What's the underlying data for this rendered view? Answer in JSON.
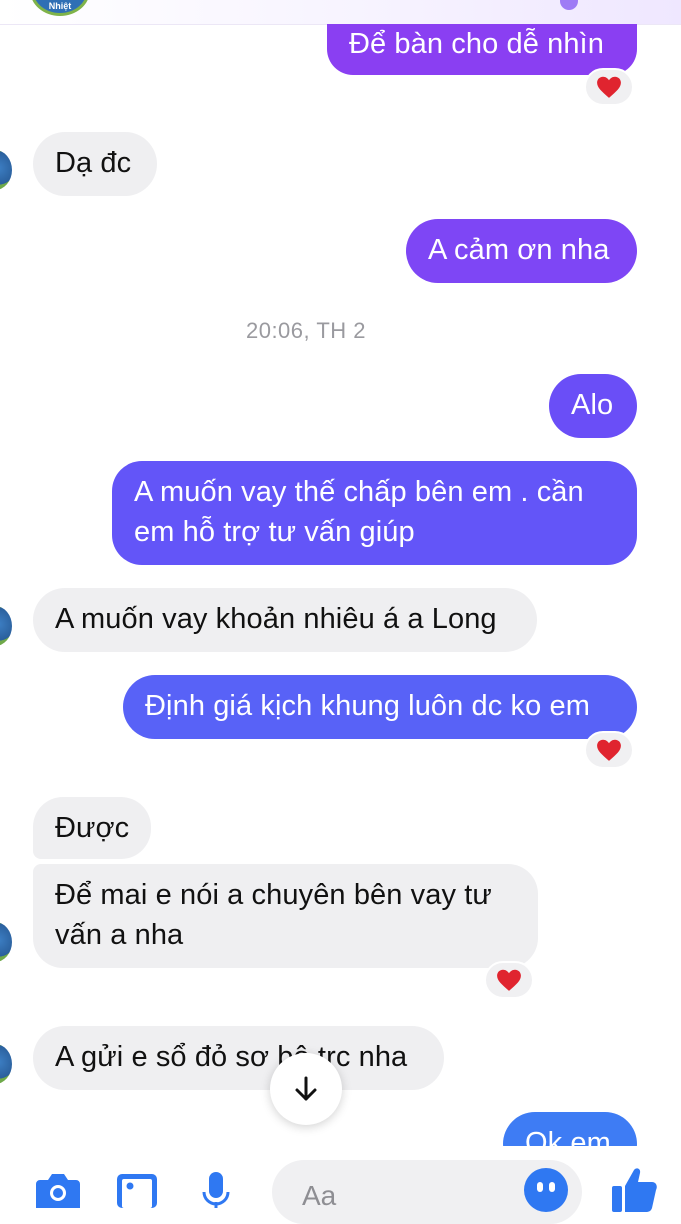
{
  "header": {
    "avatar_text": "Nhiệt"
  },
  "messages": {
    "sent_1": "Để bàn cho dễ nhìn",
    "recv_1": "Dạ đc",
    "sent_2": "A cảm ơn nha",
    "timestamp": "20:06, TH 2",
    "sent_3": "Alo",
    "sent_4": "A muốn vay thế chấp bên em . cần\nem hỗ trợ tư vấn giúp",
    "recv_2": "A muốn vay khoản nhiêu á a Long",
    "sent_5": "Định giá kịch khung luôn dc ko em",
    "recv_3": "Được",
    "recv_4": "Để mai e nói a chuyên bên vay tư\nvấn a nha",
    "recv_5": "A gửi e sổ đỏ sơ bộ trc nha",
    "sent_6": "Ok em"
  },
  "reactions": {
    "icon": "heart-icon",
    "color": "#e0242f"
  },
  "composer": {
    "placeholder": "Aa",
    "accent": "#2f78f2"
  },
  "colors": {
    "received_bubble": "#efeff1",
    "sent_gradient_top": "#8a3ff2",
    "sent_gradient_bottom": "#3e7cf4"
  }
}
